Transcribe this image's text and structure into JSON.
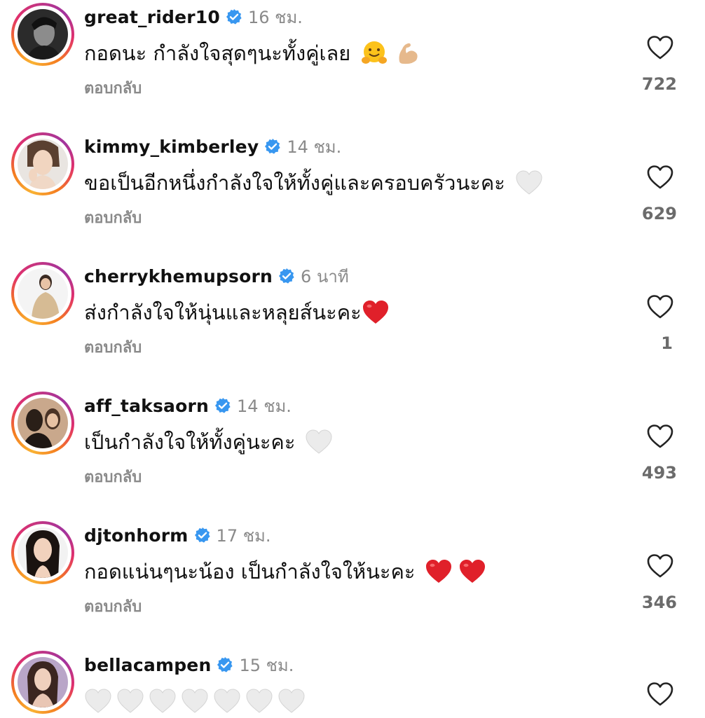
{
  "reply_label": "ตอบกลับ",
  "colors": {
    "verified_badge": "#3897f0",
    "secondary_text": "#8a8a8a",
    "red_heart": "#e0202a",
    "white_heart": "#e6e6e6"
  },
  "comments": [
    {
      "username": "great_rider10",
      "verified": true,
      "time": "16 ชม.",
      "text": "กอดนะ กำลังใจสุดๆนะทั้งคู่เลย",
      "emojis": [
        "hugging-face-emoji",
        "flexed-biceps-emoji"
      ],
      "likes": "722"
    },
    {
      "username": "kimmy_kimberley",
      "verified": true,
      "time": "14 ชม.",
      "text": "ขอเป็นอีกหนึ่งกำลังใจให้ทั้งคู่และครอบครัวนะคะ",
      "emojis": [
        "white-heart-emoji"
      ],
      "likes": "629"
    },
    {
      "username": "cherrykhemupsorn",
      "verified": true,
      "time": "6 นาที",
      "text": "ส่งกำลังใจให้นุ่นและหลุยส์นะคะ",
      "emojis": [
        "red-heart-emoji"
      ],
      "likes": "1"
    },
    {
      "username": "aff_taksaorn",
      "verified": true,
      "time": "14 ชม.",
      "text": "เป็นกำลังใจให้ทั้งคู่นะคะ",
      "emojis": [
        "white-heart-emoji"
      ],
      "likes": "493"
    },
    {
      "username": "djtonhorm",
      "verified": true,
      "time": "17 ชม.",
      "text": "กอดแน่นๆนะน้อง เป็นกำลังใจให้นะคะ",
      "emojis": [
        "red-heart-emoji",
        "red-heart-emoji"
      ],
      "likes": "346"
    },
    {
      "username": "bellacampen",
      "verified": true,
      "time": "15 ชม.",
      "text": "",
      "emojis": [
        "white-heart-emoji",
        "white-heart-emoji",
        "white-heart-emoji",
        "white-heart-emoji",
        "white-heart-emoji",
        "white-heart-emoji",
        "white-heart-emoji"
      ],
      "likes": ""
    }
  ]
}
